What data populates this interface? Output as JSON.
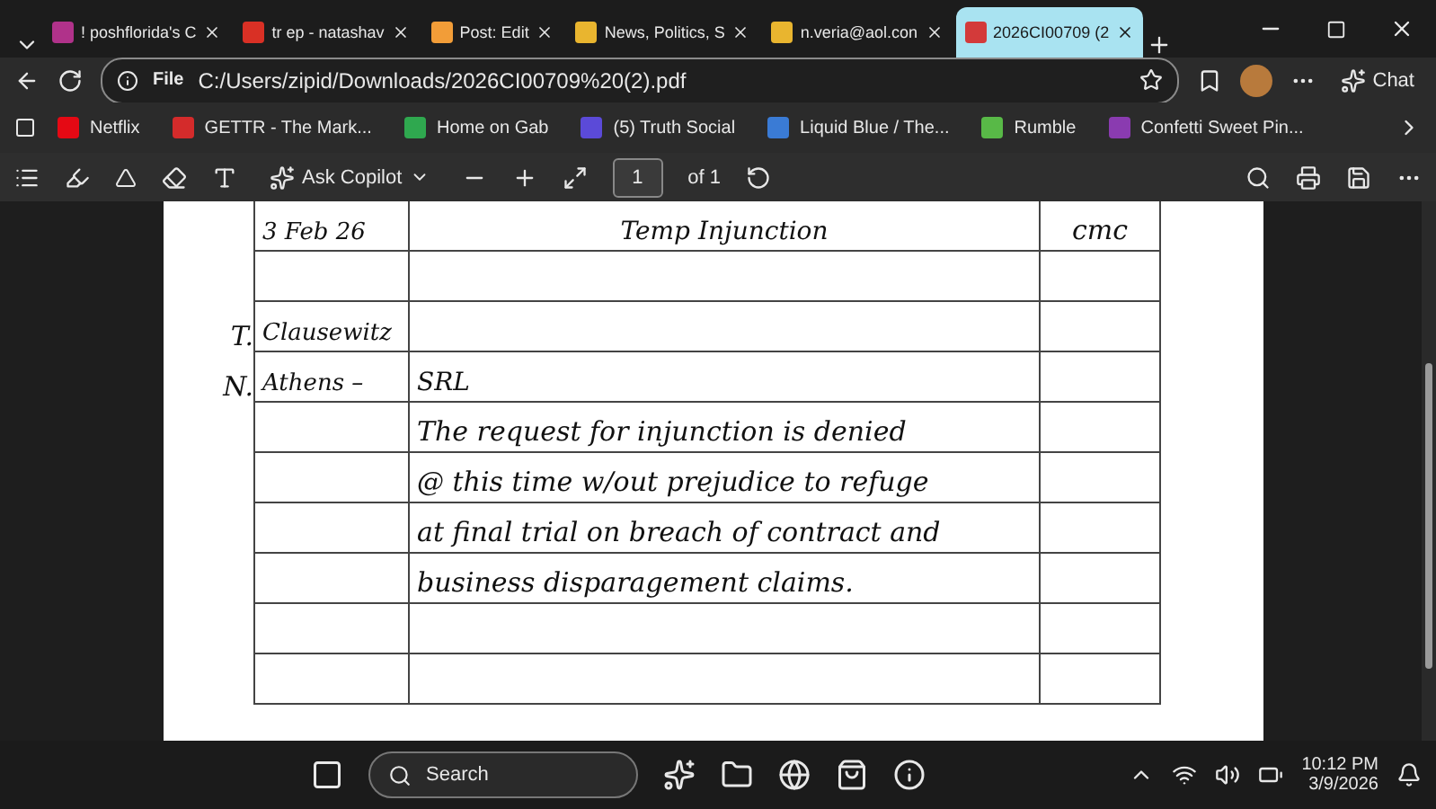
{
  "tabs": [
    {
      "label": "! poshflorida's C",
      "selected": false
    },
    {
      "label": "tr ep - natashav",
      "selected": false
    },
    {
      "label": "Post: Edit",
      "selected": false
    },
    {
      "label": "News, Politics, S",
      "selected": false
    },
    {
      "label": "n.veria@aol.con",
      "selected": false
    },
    {
      "label": "2026CI00709 (2",
      "selected": true
    }
  ],
  "address": {
    "scheme": "File",
    "url": "C:/Users/zipid/Downloads/2026CI00709%20(2).pdf"
  },
  "chat_button": "Chat",
  "bookmarks": [
    "Netflix",
    "GETTR - The Mark...",
    "Home on Gab",
    "(5) Truth Social",
    "Liquid Blue / The...",
    "Rumble",
    "Confetti Sweet Pin..."
  ],
  "pdf_toolbar": {
    "copilot": "Ask Copilot",
    "page": "1",
    "page_count": "of 1"
  },
  "document": {
    "rows": [
      {
        "margin": "",
        "date": "3 Feb 26",
        "entry": "Temp Injunction",
        "initials": "cmc"
      },
      {
        "margin": "",
        "date": "",
        "entry": "",
        "initials": ""
      },
      {
        "margin": "T.",
        "date": "Clausewitz",
        "entry": "",
        "initials": ""
      },
      {
        "margin": "N.",
        "date": "Athens –",
        "entry": "SRL",
        "initials": ""
      },
      {
        "margin": "",
        "date": "",
        "entry": "The request for injunction is denied",
        "initials": ""
      },
      {
        "margin": "",
        "date": "",
        "entry": "@ this time w/out prejudice to refuge",
        "initials": ""
      },
      {
        "margin": "",
        "date": "",
        "entry": "at final trial on breach of contract and",
        "initials": ""
      },
      {
        "margin": "",
        "date": "",
        "entry": "business disparagement claims.",
        "initials": ""
      },
      {
        "margin": "",
        "date": "",
        "entry": "",
        "initials": ""
      },
      {
        "margin": "",
        "date": "",
        "entry": "",
        "initials": ""
      }
    ]
  },
  "taskbar": {
    "search": "Search",
    "time": "10:12 PM",
    "date": "3/9/2026"
  }
}
